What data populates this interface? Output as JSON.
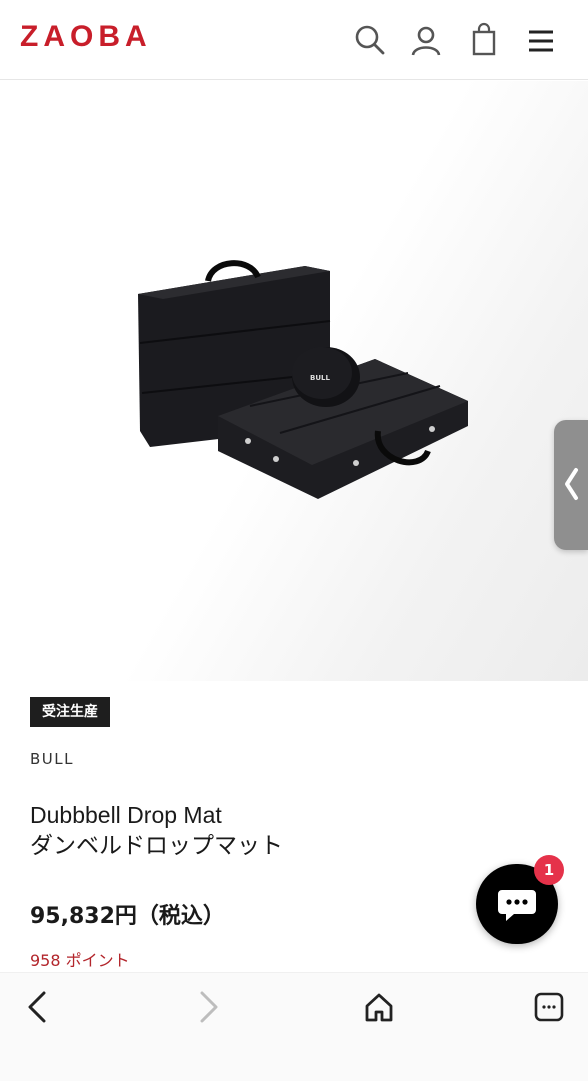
{
  "header": {
    "logo": "ZAOBA",
    "icons": [
      "search-icon",
      "account-icon",
      "cart-icon",
      "menu-icon"
    ]
  },
  "product": {
    "badge": "受注生産",
    "brand": "BULL",
    "title_en": "Dubbbell Drop Mat",
    "title_ja": "ダンベルドロップマット",
    "price": "95,832円（税込）",
    "points": "958 ポイント",
    "image_icon": "product-photo-drop-mat-cases",
    "label_on_pad": "BULL"
  },
  "chat": {
    "unread_count": "1",
    "icon": "chat-bubble-icon"
  },
  "side_panel": {
    "icon": "chevron-left-icon"
  },
  "browser_nav": {
    "icons": [
      "back-arrow-icon",
      "forward-arrow-icon",
      "home-icon",
      "tabs-icon"
    ]
  },
  "colors": {
    "brand": "#c81e2a",
    "points": "#b3262c",
    "badge_bg": "#1e1e1e",
    "chat_count_bg": "#e5324a"
  }
}
